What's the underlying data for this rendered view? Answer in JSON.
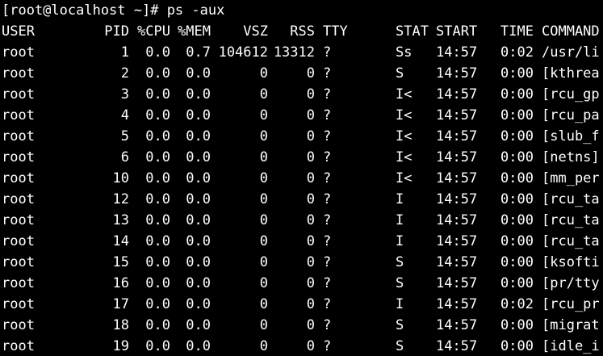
{
  "terminal": {
    "prompt": "[root@localhost ~]# ps -aux",
    "header": {
      "user": "USER",
      "pid": "PID",
      "cpu": "%CPU",
      "mem": "%MEM",
      "vsz": "VSZ",
      "rss": "RSS",
      "tty": "TTY",
      "stat": "STAT",
      "start": "START",
      "time": "TIME",
      "command": "COMMAND"
    },
    "processes": [
      {
        "user": "root",
        "pid": "1",
        "cpu": "0.0",
        "mem": "0.7",
        "vsz": "104612",
        "rss": "13312",
        "tty": "?",
        "stat": "Ss",
        "start": "14:57",
        "time": "0:02",
        "command": "/usr/li"
      },
      {
        "user": "root",
        "pid": "2",
        "cpu": "0.0",
        "mem": "0.0",
        "vsz": "0",
        "rss": "0",
        "tty": "?",
        "stat": "S",
        "start": "14:57",
        "time": "0:00",
        "command": "[kthrea"
      },
      {
        "user": "root",
        "pid": "3",
        "cpu": "0.0",
        "mem": "0.0",
        "vsz": "0",
        "rss": "0",
        "tty": "?",
        "stat": "I<",
        "start": "14:57",
        "time": "0:00",
        "command": "[rcu_gp"
      },
      {
        "user": "root",
        "pid": "4",
        "cpu": "0.0",
        "mem": "0.0",
        "vsz": "0",
        "rss": "0",
        "tty": "?",
        "stat": "I<",
        "start": "14:57",
        "time": "0:00",
        "command": "[rcu_pa"
      },
      {
        "user": "root",
        "pid": "5",
        "cpu": "0.0",
        "mem": "0.0",
        "vsz": "0",
        "rss": "0",
        "tty": "?",
        "stat": "I<",
        "start": "14:57",
        "time": "0:00",
        "command": "[slub_f"
      },
      {
        "user": "root",
        "pid": "6",
        "cpu": "0.0",
        "mem": "0.0",
        "vsz": "0",
        "rss": "0",
        "tty": "?",
        "stat": "I<",
        "start": "14:57",
        "time": "0:00",
        "command": "[netns]"
      },
      {
        "user": "root",
        "pid": "10",
        "cpu": "0.0",
        "mem": "0.0",
        "vsz": "0",
        "rss": "0",
        "tty": "?",
        "stat": "I<",
        "start": "14:57",
        "time": "0:00",
        "command": "[mm_per"
      },
      {
        "user": "root",
        "pid": "12",
        "cpu": "0.0",
        "mem": "0.0",
        "vsz": "0",
        "rss": "0",
        "tty": "?",
        "stat": "I",
        "start": "14:57",
        "time": "0:00",
        "command": "[rcu_ta"
      },
      {
        "user": "root",
        "pid": "13",
        "cpu": "0.0",
        "mem": "0.0",
        "vsz": "0",
        "rss": "0",
        "tty": "?",
        "stat": "I",
        "start": "14:57",
        "time": "0:00",
        "command": "[rcu_ta"
      },
      {
        "user": "root",
        "pid": "14",
        "cpu": "0.0",
        "mem": "0.0",
        "vsz": "0",
        "rss": "0",
        "tty": "?",
        "stat": "I",
        "start": "14:57",
        "time": "0:00",
        "command": "[rcu_ta"
      },
      {
        "user": "root",
        "pid": "15",
        "cpu": "0.0",
        "mem": "0.0",
        "vsz": "0",
        "rss": "0",
        "tty": "?",
        "stat": "S",
        "start": "14:57",
        "time": "0:00",
        "command": "[ksofti"
      },
      {
        "user": "root",
        "pid": "16",
        "cpu": "0.0",
        "mem": "0.0",
        "vsz": "0",
        "rss": "0",
        "tty": "?",
        "stat": "S",
        "start": "14:57",
        "time": "0:00",
        "command": "[pr/tty"
      },
      {
        "user": "root",
        "pid": "17",
        "cpu": "0.0",
        "mem": "0.0",
        "vsz": "0",
        "rss": "0",
        "tty": "?",
        "stat": "I",
        "start": "14:57",
        "time": "0:02",
        "command": "[rcu_pr"
      },
      {
        "user": "root",
        "pid": "18",
        "cpu": "0.0",
        "mem": "0.0",
        "vsz": "0",
        "rss": "0",
        "tty": "?",
        "stat": "S",
        "start": "14:57",
        "time": "0:00",
        "command": "[migrat"
      },
      {
        "user": "root",
        "pid": "19",
        "cpu": "0.0",
        "mem": "0.0",
        "vsz": "0",
        "rss": "0",
        "tty": "?",
        "stat": "S",
        "start": "14:57",
        "time": "0:00",
        "command": "[idle_i"
      }
    ],
    "colors": {
      "background": "#000000",
      "foreground": "#ffffff"
    }
  }
}
